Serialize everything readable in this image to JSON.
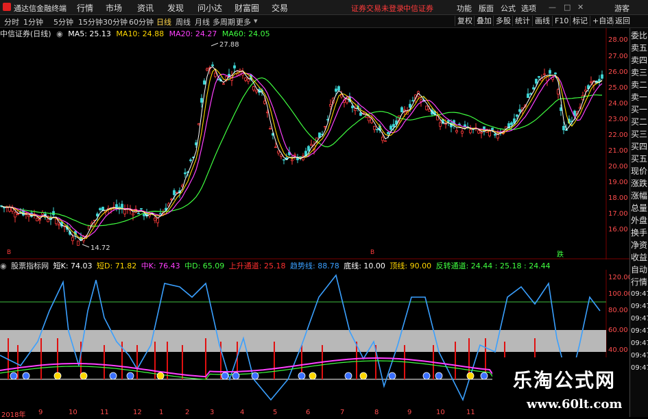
{
  "menu": {
    "app_name": "通达信金融终端",
    "items": [
      "行情",
      "市场",
      "资讯",
      "发现",
      "问小达",
      "财富圈",
      "交易"
    ],
    "status_red": "证券交易未登录",
    "broker": "中信证券",
    "right_items": [
      "功能",
      "版面",
      "公式",
      "选项"
    ],
    "guest": "游客"
  },
  "toolbar": {
    "periods": [
      "分时",
      "1分钟",
      "5分钟",
      "15分钟",
      "30分钟",
      "60分钟",
      "日线",
      "周线",
      "月线",
      "多周期",
      "更多"
    ],
    "active": "日线",
    "buttons": [
      "复权",
      "叠加",
      "多股",
      "统计",
      "画线",
      "F10",
      "标记",
      "+自选",
      "返回"
    ]
  },
  "main_chart": {
    "title": "中信证券(日线)",
    "ma": [
      {
        "label": "MA5: 25.13",
        "color": "#ffffff"
      },
      {
        "label": "MA10: 24.88",
        "color": "#ffd700"
      },
      {
        "label": "MA20: 24.27",
        "color": "#ff40ff"
      },
      {
        "label": "MA60: 24.05",
        "color": "#40ff40"
      }
    ],
    "high_label": "27.88",
    "low_label": "14.72",
    "price_ticks": [
      "28.00",
      "27.00",
      "26.00",
      "25.00",
      "24.00",
      "23.00",
      "22.00",
      "21.00",
      "20.00",
      "19.00",
      "18.00",
      "17.00",
      "16.00"
    ],
    "markers": {
      "left": "B",
      "mid": "B",
      "sell": "跌"
    }
  },
  "right_panel": {
    "items": [
      "委比",
      "卖五",
      "卖四",
      "卖三",
      "卖二",
      "卖一",
      "买一",
      "买二",
      "买三",
      "买四",
      "买五",
      "现价",
      "涨跌",
      "涨幅",
      "总量",
      "外盘",
      "换手",
      "净资",
      "收益"
    ],
    "lower_items": [
      "自动",
      "行情"
    ],
    "times": [
      "09:47",
      "09:47",
      "09:47",
      "09:47",
      "09:47",
      "09:47",
      "09:47"
    ]
  },
  "indicator": {
    "name": "股票指标网",
    "legend": [
      {
        "label": "短K: 74.03",
        "color": "#ffffff"
      },
      {
        "label": "短D: 71.82",
        "color": "#ffd700"
      },
      {
        "label": "中K: 76.43",
        "color": "#ff40ff"
      },
      {
        "label": "中D: 65.09",
        "color": "#40ff40"
      },
      {
        "label": "上升通道: 25.18",
        "color": "#ff3030"
      },
      {
        "label": "趋势线: 88.78",
        "color": "#3aa0ff"
      },
      {
        "label": "底线: 10.00",
        "color": "#ffffff"
      },
      {
        "label": "顶线: 90.00",
        "color": "#ffd700"
      },
      {
        "label": "反转通道: 24.44 : 25.18 : 24.44",
        "color": "#40ff40"
      }
    ],
    "ticks": [
      "120.00",
      "100.00",
      "80.00",
      "60.00",
      "40.00"
    ]
  },
  "date_axis": [
    "2018年",
    "9",
    "10",
    "11",
    "12",
    "1",
    "2",
    "3",
    "4",
    "5",
    "6",
    "7",
    "8",
    "9",
    "10",
    "11"
  ],
  "watermark": {
    "title": "乐淘公式网",
    "url": "www.60lt.com"
  }
}
